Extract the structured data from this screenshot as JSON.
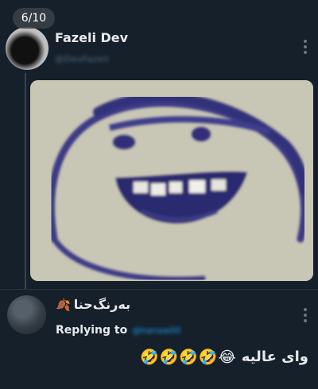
{
  "media_counter": "6/10",
  "tweet": {
    "author_name": "Fazeli Dev",
    "author_handle": "@DevFazeli",
    "image_alt_icon": "smiley-face-drawing"
  },
  "reply": {
    "author_name": "به‌رنگ‌حنا",
    "name_emoji": "🍂",
    "replying_label": "Replying to",
    "replying_to": "@hanaw00",
    "text": "وای عالیه",
    "emojis": "😂🤣🤣🤣🤣"
  }
}
